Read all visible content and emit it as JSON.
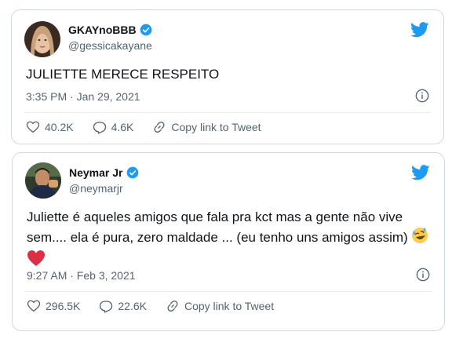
{
  "tweets": [
    {
      "name": "GKAYnoBBB",
      "handle": "@gessicakayane",
      "text": "JULIETTE MERECE RESPEITO",
      "meta": "3:35 PM · Jan 29, 2021",
      "likes": "40.2K",
      "replies": "4.6K",
      "copy_link_label": "Copy link to Tweet"
    },
    {
      "name": "Neymar Jr",
      "handle": "@neymarjr",
      "text": "Juliette é aqueles amigos que fala pra kct mas a gente não vive sem.... ela é pura, zero maldade ... (eu tenho uns amigos assim) ",
      "meta": "9:27 AM · Feb 3, 2021",
      "likes": "296.5K",
      "replies": "22.6K",
      "copy_link_label": "Copy link to Tweet"
    }
  ],
  "colors": {
    "brand": "#1d9bf0",
    "border": "#cfd9de",
    "secondary_text": "#536471",
    "heart": "#e0245e"
  },
  "icons": {
    "bird": "twitter-bird-icon",
    "verified": "verified-badge-icon",
    "info": "info-icon",
    "like": "heart-outline-icon",
    "reply": "reply-bubble-icon",
    "link": "link-icon",
    "emoji_laugh": "rolling-laughing-emoji",
    "emoji_heart": "red-heart-emoji"
  }
}
